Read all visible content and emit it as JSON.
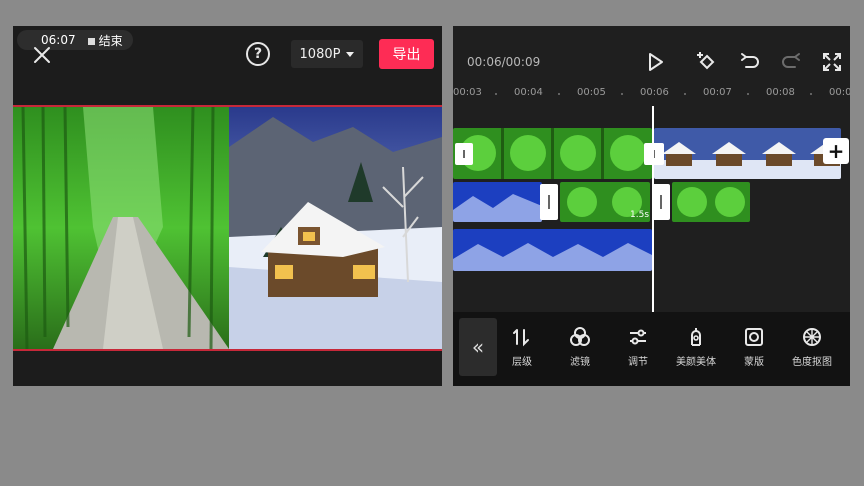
{
  "preview_panel": {
    "recording": {
      "time": "06:07",
      "stop_label": "结束"
    },
    "resolution": "1080P",
    "export_label": "导出"
  },
  "editor_panel": {
    "time_readout": "00:06/00:09",
    "ruler": [
      "00:03",
      "00:04",
      "00:05",
      "00:06",
      "00:07",
      "00:08",
      "00:0"
    ],
    "transition_duration": "1.5s",
    "add_clip_label": "+",
    "collapse_label": "«",
    "toolbar": [
      {
        "label": "层级",
        "icon": "layer-order-icon"
      },
      {
        "label": "滤镜",
        "icon": "filter-icon"
      },
      {
        "label": "调节",
        "icon": "adjust-sliders-icon"
      },
      {
        "label": "美颜美体",
        "icon": "beauty-icon"
      },
      {
        "label": "蒙版",
        "icon": "mask-icon"
      },
      {
        "label": "色度抠图",
        "icon": "chroma-key-icon"
      }
    ]
  },
  "colors": {
    "accent": "#fe2c55",
    "preview_border": "#c62839",
    "panel_bg": "#1c1c1c"
  }
}
